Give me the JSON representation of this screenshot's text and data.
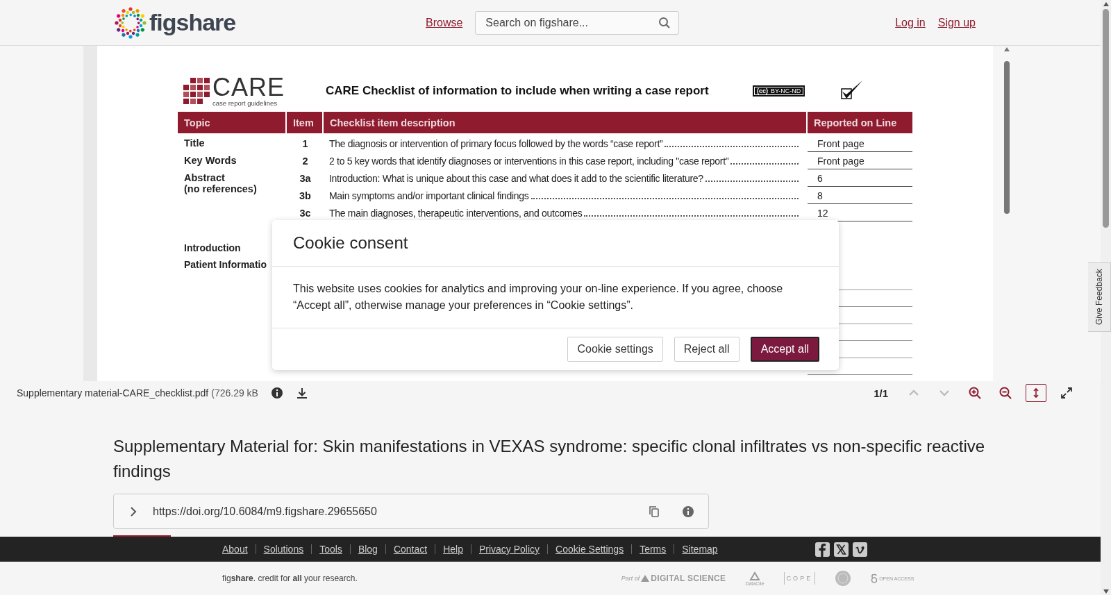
{
  "header": {
    "brand": "figshare",
    "nav": [
      {
        "label": "Browse"
      }
    ],
    "search": {
      "placeholder": "Search on figshare..."
    },
    "auth": [
      {
        "label": "Log in"
      },
      {
        "label": "Sign up"
      }
    ]
  },
  "document": {
    "logo": {
      "name": "CARE",
      "tagline": "case report guidelines"
    },
    "heading": "CARE Checklist of information to include when writing a case report",
    "license": {
      "mark": "(cc)",
      "terms": "BY-NC-ND"
    },
    "columns": [
      "Topic",
      "Item",
      "Checklist item description",
      "Reported on Line"
    ],
    "rows": [
      {
        "topic": "Title",
        "item": "1",
        "description": "The diagnosis or intervention of primary focus followed by the words “case report”",
        "line": "Front page"
      },
      {
        "topic": "Key Words",
        "item": "2",
        "description": "2 to 5 key words that identify diagnoses or interventions in this case report, including \"case report\"",
        "line": "Front page"
      },
      {
        "topic": "Abstract",
        "topic_note": "(no references)",
        "item": "3a",
        "description": "Introduction: What is unique about this case and what does it add to the scientific literature?",
        "line": "6"
      },
      {
        "item": "3b",
        "description": "Main symptoms and/or important clinical findings",
        "line": "8"
      },
      {
        "item": "3c",
        "description": "The main diagnoses, therapeutic interventions, and outcomes",
        "line": "12"
      }
    ],
    "sections": [
      {
        "label": "Introduction"
      },
      {
        "label": "Patient Informatio"
      }
    ]
  },
  "viewer": {
    "file": "Supplementary material-CARE_checklist.pdf",
    "size": "(726.29 kB",
    "page": "1/1",
    "tools": [
      {
        "kind": "up",
        "disabled": true,
        "selected": false
      },
      {
        "kind": "down",
        "disabled": true,
        "selected": false
      },
      {
        "kind": "zoom-in",
        "disabled": false,
        "selected": false
      },
      {
        "kind": "zoom-out",
        "disabled": false,
        "selected": false
      },
      {
        "kind": "fit",
        "disabled": false,
        "selected": true
      },
      {
        "kind": "fullscreen",
        "disabled": false,
        "selected": false
      }
    ]
  },
  "title": "Supplementary Material for: Skin manifestations in VEXAS syndrome: specific clonal infiltrates vs non-specific reactive findings",
  "doi": "https://doi.org/10.6084/m9.figshare.29655650",
  "footer": {
    "links": [
      "About",
      "Solutions",
      "Tools",
      "Blog",
      "Contact",
      "Help",
      "Privacy Policy",
      "Cookie Settings",
      "Terms",
      "Sitemap"
    ],
    "social": [
      {
        "kind": "facebook"
      },
      {
        "kind": "x"
      },
      {
        "kind": "vimeo"
      }
    ],
    "tagline": "fig**share**. credit for **all** your research.",
    "partners": [
      {
        "kind": "digital-science",
        "label": "DIGITAL SCIENCE",
        "prefix": "Part of"
      },
      {
        "kind": "datacite",
        "label": "DataCite"
      },
      {
        "kind": "cope",
        "label": "COPE"
      },
      {
        "kind": "seal"
      },
      {
        "kind": "open-access",
        "label": "OPEN ACCESS"
      }
    ]
  },
  "feedback": "Give Feedback",
  "modal": {
    "title": "Cookie consent",
    "body": "This website uses cookies for analytics and improving your on-line experience. If you agree, choose “Accept all”, otherwise manage your preferences in “Cookie settings”.",
    "buttons": [
      {
        "label": "Cookie settings",
        "primary": false
      },
      {
        "label": "Reject all",
        "primary": false
      },
      {
        "label": "Accept all",
        "primary": true
      }
    ]
  }
}
